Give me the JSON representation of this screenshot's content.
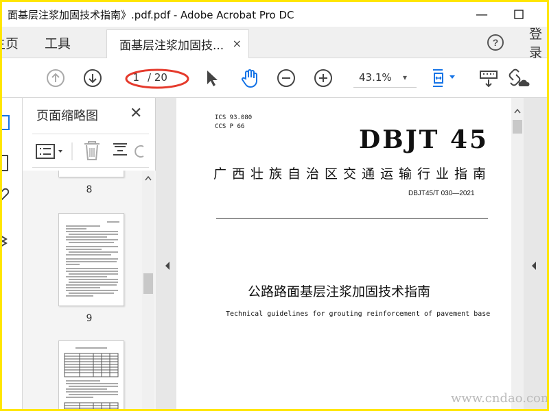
{
  "window": {
    "title": "面基层注浆加固技术指南》.pdf.pdf - Adobe Acrobat Pro DC",
    "minimize": "—",
    "maximize": "☐"
  },
  "tabs": {
    "home": "主页",
    "tools": "工具",
    "document": "面基层注浆加固技...",
    "close": "×",
    "help": "?",
    "signin": "登录"
  },
  "toolbar": {
    "page_current": "1",
    "page_total": "/ 20",
    "zoom": "43.1%",
    "zoom_caret": "▾",
    "annotation_color": "#e53a2c"
  },
  "thumbnails": {
    "title": "页面缩略图",
    "close": "✕",
    "pages": [
      "8",
      "9"
    ]
  },
  "document": {
    "ics": "ICS  93.080",
    "ccs": "CCS  P 66",
    "logo": "DBJT 45",
    "standard_title": "广西壮族自治区交通运输行业指南",
    "standard_code": "DBJT45/T 030—2021",
    "cn_title": "公路路面基层注浆加固技术指南",
    "en_title": "Technical guidelines for grouting reinforcement of pavement base"
  },
  "watermark": "www.cndao.com"
}
